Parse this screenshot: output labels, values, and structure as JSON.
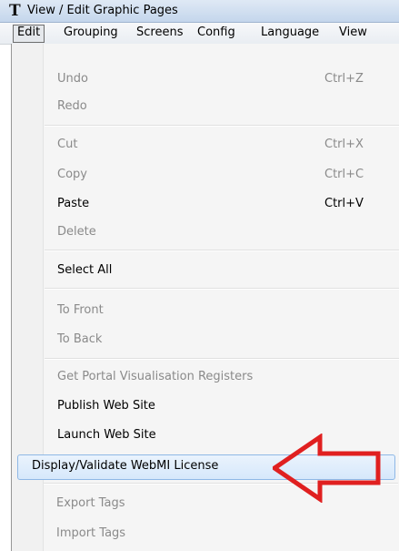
{
  "window": {
    "title": "View / Edit Graphic Pages",
    "icon": "T"
  },
  "menubar": [
    "Edit",
    "Grouping",
    "Screens",
    "Config",
    "Language",
    "View"
  ],
  "edit_menu": {
    "undo": {
      "label": "Undo",
      "shortcut": "Ctrl+Z"
    },
    "redo": {
      "label": "Redo"
    },
    "cut": {
      "label": "Cut",
      "shortcut": "Ctrl+X"
    },
    "copy": {
      "label": "Copy",
      "shortcut": "Ctrl+C"
    },
    "paste": {
      "label": "Paste",
      "shortcut": "Ctrl+V"
    },
    "delete": {
      "label": "Delete"
    },
    "select_all": {
      "label": "Select All"
    },
    "to_front": {
      "label": "To Front"
    },
    "to_back": {
      "label": "To Back"
    },
    "portal_registers": {
      "label": "Get Portal Visualisation Registers"
    },
    "publish": {
      "label": "Publish Web Site"
    },
    "launch": {
      "label": "Launch Web Site"
    },
    "webmi_license": {
      "label": "Display/Validate WebMI License"
    },
    "export_tags": {
      "label": "Export Tags"
    },
    "import_tags": {
      "label": "Import Tags"
    }
  },
  "colors": {
    "annotation_arrow": "#e02020",
    "highlight": "#d6e8fb"
  }
}
